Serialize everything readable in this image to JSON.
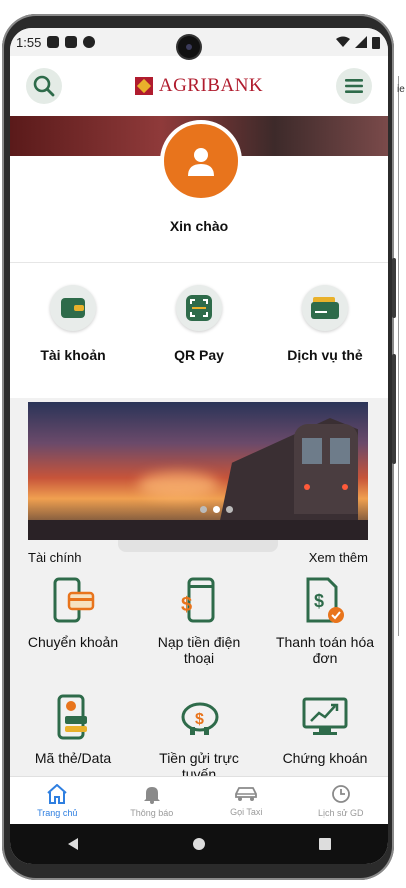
{
  "status_bar": {
    "time": "1:55"
  },
  "header": {
    "brand": "AGRIBANK"
  },
  "greeting": "Xin chào",
  "quick_actions": [
    {
      "label": "Tài khoản",
      "icon": "wallet-icon"
    },
    {
      "label": "QR Pay",
      "icon": "qr-scan-icon"
    },
    {
      "label": "Dịch vụ thẻ",
      "icon": "card-service-icon"
    }
  ],
  "services": {
    "title": "Tài chính",
    "see_more": "Xem thêm",
    "items": [
      {
        "label": "Chuyển khoản",
        "icon": "transfer-icon"
      },
      {
        "label": "Nạp tiền điện thoại",
        "icon": "phone-topup-icon"
      },
      {
        "label": "Thanh toán hóa đơn",
        "icon": "bill-payment-icon"
      },
      {
        "label": "Mã thẻ/Data",
        "icon": "card-data-icon"
      },
      {
        "label": "Tiền gửi trực tuyến",
        "icon": "piggy-bank-icon"
      },
      {
        "label": "Chứng khoán",
        "icon": "stock-chart-icon"
      }
    ]
  },
  "bottom_nav": [
    {
      "label": "Trang chủ",
      "icon": "home-icon",
      "active": true
    },
    {
      "label": "Thông báo",
      "icon": "bell-icon"
    },
    {
      "label": "Gọi Taxi",
      "icon": "car-icon"
    },
    {
      "label": "Lịch sử GD",
      "icon": "clock-icon"
    }
  ],
  "colors": {
    "primary_green": "#2e6b4a",
    "brand_red": "#b01c2e",
    "accent_orange": "#e8741c",
    "active_blue": "#2f7fe0"
  }
}
